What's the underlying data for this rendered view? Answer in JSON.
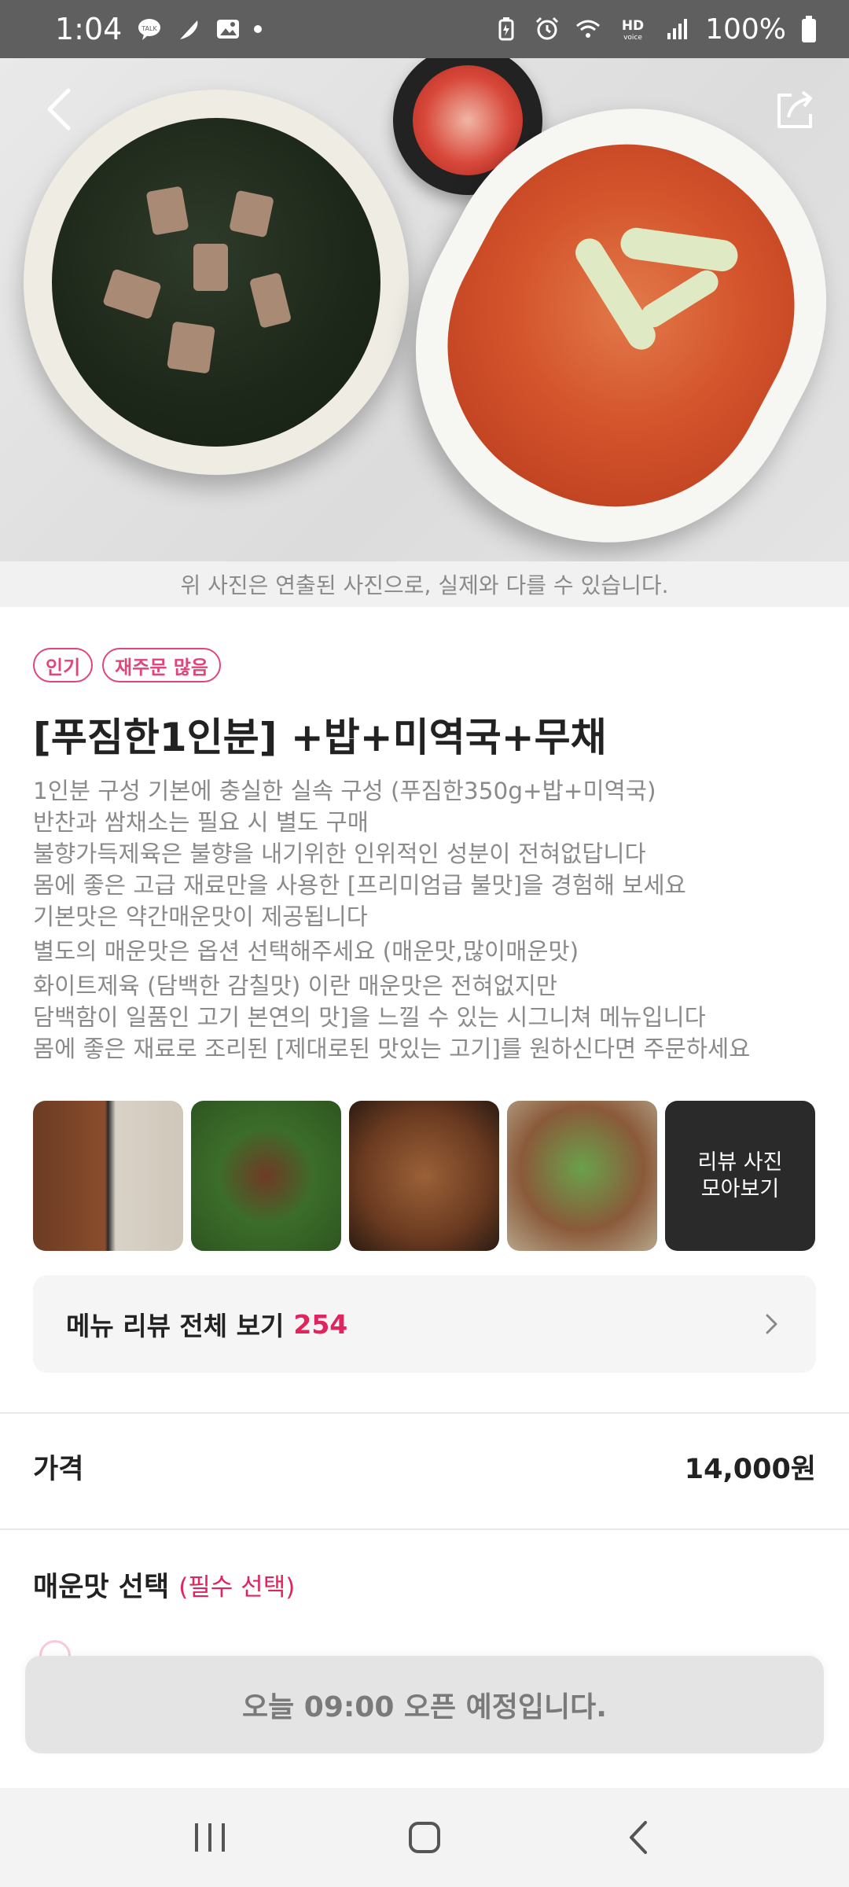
{
  "status_bar": {
    "time": "1:04",
    "battery": "100%",
    "left_icons": [
      "kakaotalk-icon",
      "feather-icon",
      "gallery-icon",
      "dot-icon"
    ],
    "right_icons": [
      "battery-saver-icon",
      "alarm-icon",
      "wifi-icon",
      "hd-voice-icon",
      "signal-icon",
      "battery-icon"
    ]
  },
  "hero": {
    "back_icon": "back-arrow-icon",
    "share_icon": "share-icon",
    "photo_note": "위 사진은 연출된 사진으로, 실제와 다를 수 있습니다."
  },
  "badges": [
    "인기",
    "재주문 많음"
  ],
  "menu": {
    "title": "[푸짐한1인분] +밥+미역국+무채",
    "description_lines": [
      "1인분 구성 기본에 충실한 실속 구성 (푸짐한350g+밥+미역국)",
      " 반찬과 쌈채소는 필요 시 별도 구매",
      " 불향가득제육은 불향을 내기위한 인위적인 성분이 전혀없답니다",
      " 몸에 좋은 고급 재료만을 사용한 [프리미엄급 불맛]을 경험해 보세요",
      " 기본맛은 약간매운맛이 제공됩니다",
      " 별도의 매운맛은 옵션 선택해주세요 (매운맛,많이매운맛)",
      " 화이트제육 (담백한 감칠맛) 이란 매운맛은 전혀없지만",
      " 담백함이 일품인 고기 본연의 맛]을 느낄 수 있는 시그니쳐 메뉴입니다",
      " 몸에 좋은 재료로 조리된 [제대로된 맛있는 고기]를 원하신다면 주문하세요"
    ]
  },
  "thumbnails": {
    "more_label_line1": "리뷰 사진",
    "more_label_line2": "모아보기"
  },
  "review": {
    "label": "메뉴 리뷰 전체 보기",
    "count": "254"
  },
  "price": {
    "label": "가격",
    "value": "14,000원"
  },
  "spicy": {
    "label": "매운맛 선택",
    "required": "(필수 선택)"
  },
  "cta": {
    "label": "오늘 09:00 오픈 예정입니다."
  },
  "nav": {
    "icons": [
      "recent-apps-icon",
      "home-icon",
      "back-icon"
    ]
  },
  "colors": {
    "accent": "#e0245e",
    "badge": "#e0457b",
    "status_bar": "#5f5f5f"
  }
}
